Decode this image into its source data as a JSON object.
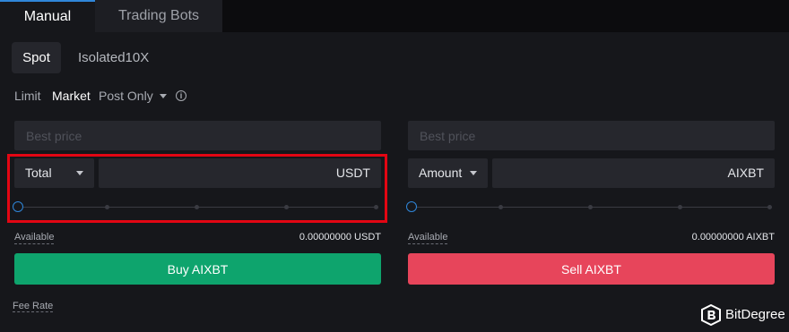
{
  "tabs": {
    "manual": "Manual",
    "trading_bots": "Trading Bots"
  },
  "modes": {
    "spot": "Spot",
    "isolated": "Isolated10X"
  },
  "order_types": {
    "limit": "Limit",
    "market": "Market",
    "post_only": "Post Only"
  },
  "buy": {
    "price_placeholder": "Best price",
    "select_label": "Total",
    "currency": "USDT",
    "available_label": "Available",
    "available_value": "0.00000000 USDT",
    "button_label": "Buy AIXBT",
    "slider_percent": 0
  },
  "sell": {
    "price_placeholder": "Best price",
    "select_label": "Amount",
    "currency": "AIXBT",
    "available_label": "Available",
    "available_value": "0.00000000 AIXBT",
    "button_label": "Sell AIXBT",
    "slider_percent": 0
  },
  "fee_rate_label": "Fee Rate",
  "watermark": {
    "brand": "BitDegree"
  },
  "colors": {
    "buy": "#0ea46d",
    "sell": "#e7455b",
    "accent": "#2f86d9",
    "highlight": "#e30613"
  },
  "icons": {
    "info": "info-circle-icon",
    "dropdown": "chevron-down-icon",
    "logo": "bitdegree-logo-icon"
  }
}
